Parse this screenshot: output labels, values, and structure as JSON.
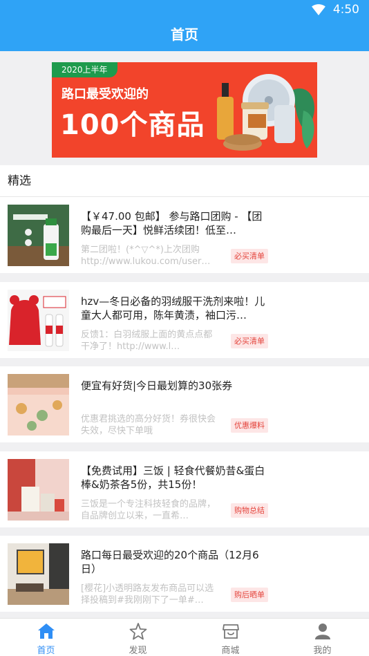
{
  "status": {
    "time": "4:50"
  },
  "header": {
    "title": "首页"
  },
  "banner": {
    "tag": "2020上半年",
    "subtitle": "路口最受欢迎的",
    "headline": "100个商品"
  },
  "section": {
    "title": "精选"
  },
  "items": [
    {
      "title": "【￥47.00 包邮】 参与路口团购 - 【团购最后一天】悦鲜活续团！低至…",
      "desc": "第二团啦！(*^▽^*)上次团购http://www.lukou.com/user…",
      "tag": "必买清单"
    },
    {
      "title": "hzv—冬日必备的羽绒服干洗剂来啦！儿童大人都可用，陈年黄渍，袖口污…",
      "desc": "反馈1：白羽绒服上面的黄点点都干净了！http://www.l…",
      "tag": "必买清单"
    },
    {
      "title": "便宜有好货|今日最划算的30张券",
      "desc": "优惠君挑选的高分好货！券很快会失效，尽快下单哦",
      "tag": "优惠爆料"
    },
    {
      "title": "【免费试用】三饭 | 轻食代餐奶昔&蛋白棒&奶茶各5份，共15份！",
      "desc": "三饭是一个专注科技轻食的品牌，自品牌创立以来，一直希…",
      "tag": "购物总结"
    },
    {
      "title": "路口每日最受欢迎的20个商品（12月6日）",
      "desc": "[樱花]小透明路友发布商品可以选择投稿到#我刚刚下了一单#…",
      "tag": "购后晒单"
    }
  ],
  "tabs": [
    {
      "label": "首页",
      "icon": "home-icon"
    },
    {
      "label": "发现",
      "icon": "star-icon"
    },
    {
      "label": "商城",
      "icon": "shop-icon"
    },
    {
      "label": "我的",
      "icon": "user-icon"
    }
  ],
  "colors": {
    "primary": "#2fa3f6",
    "active_tab": "#2f8ef5",
    "tag_text": "#e4453d",
    "tag_bg": "#fde6e6",
    "banner_bg": "#f2442b"
  }
}
